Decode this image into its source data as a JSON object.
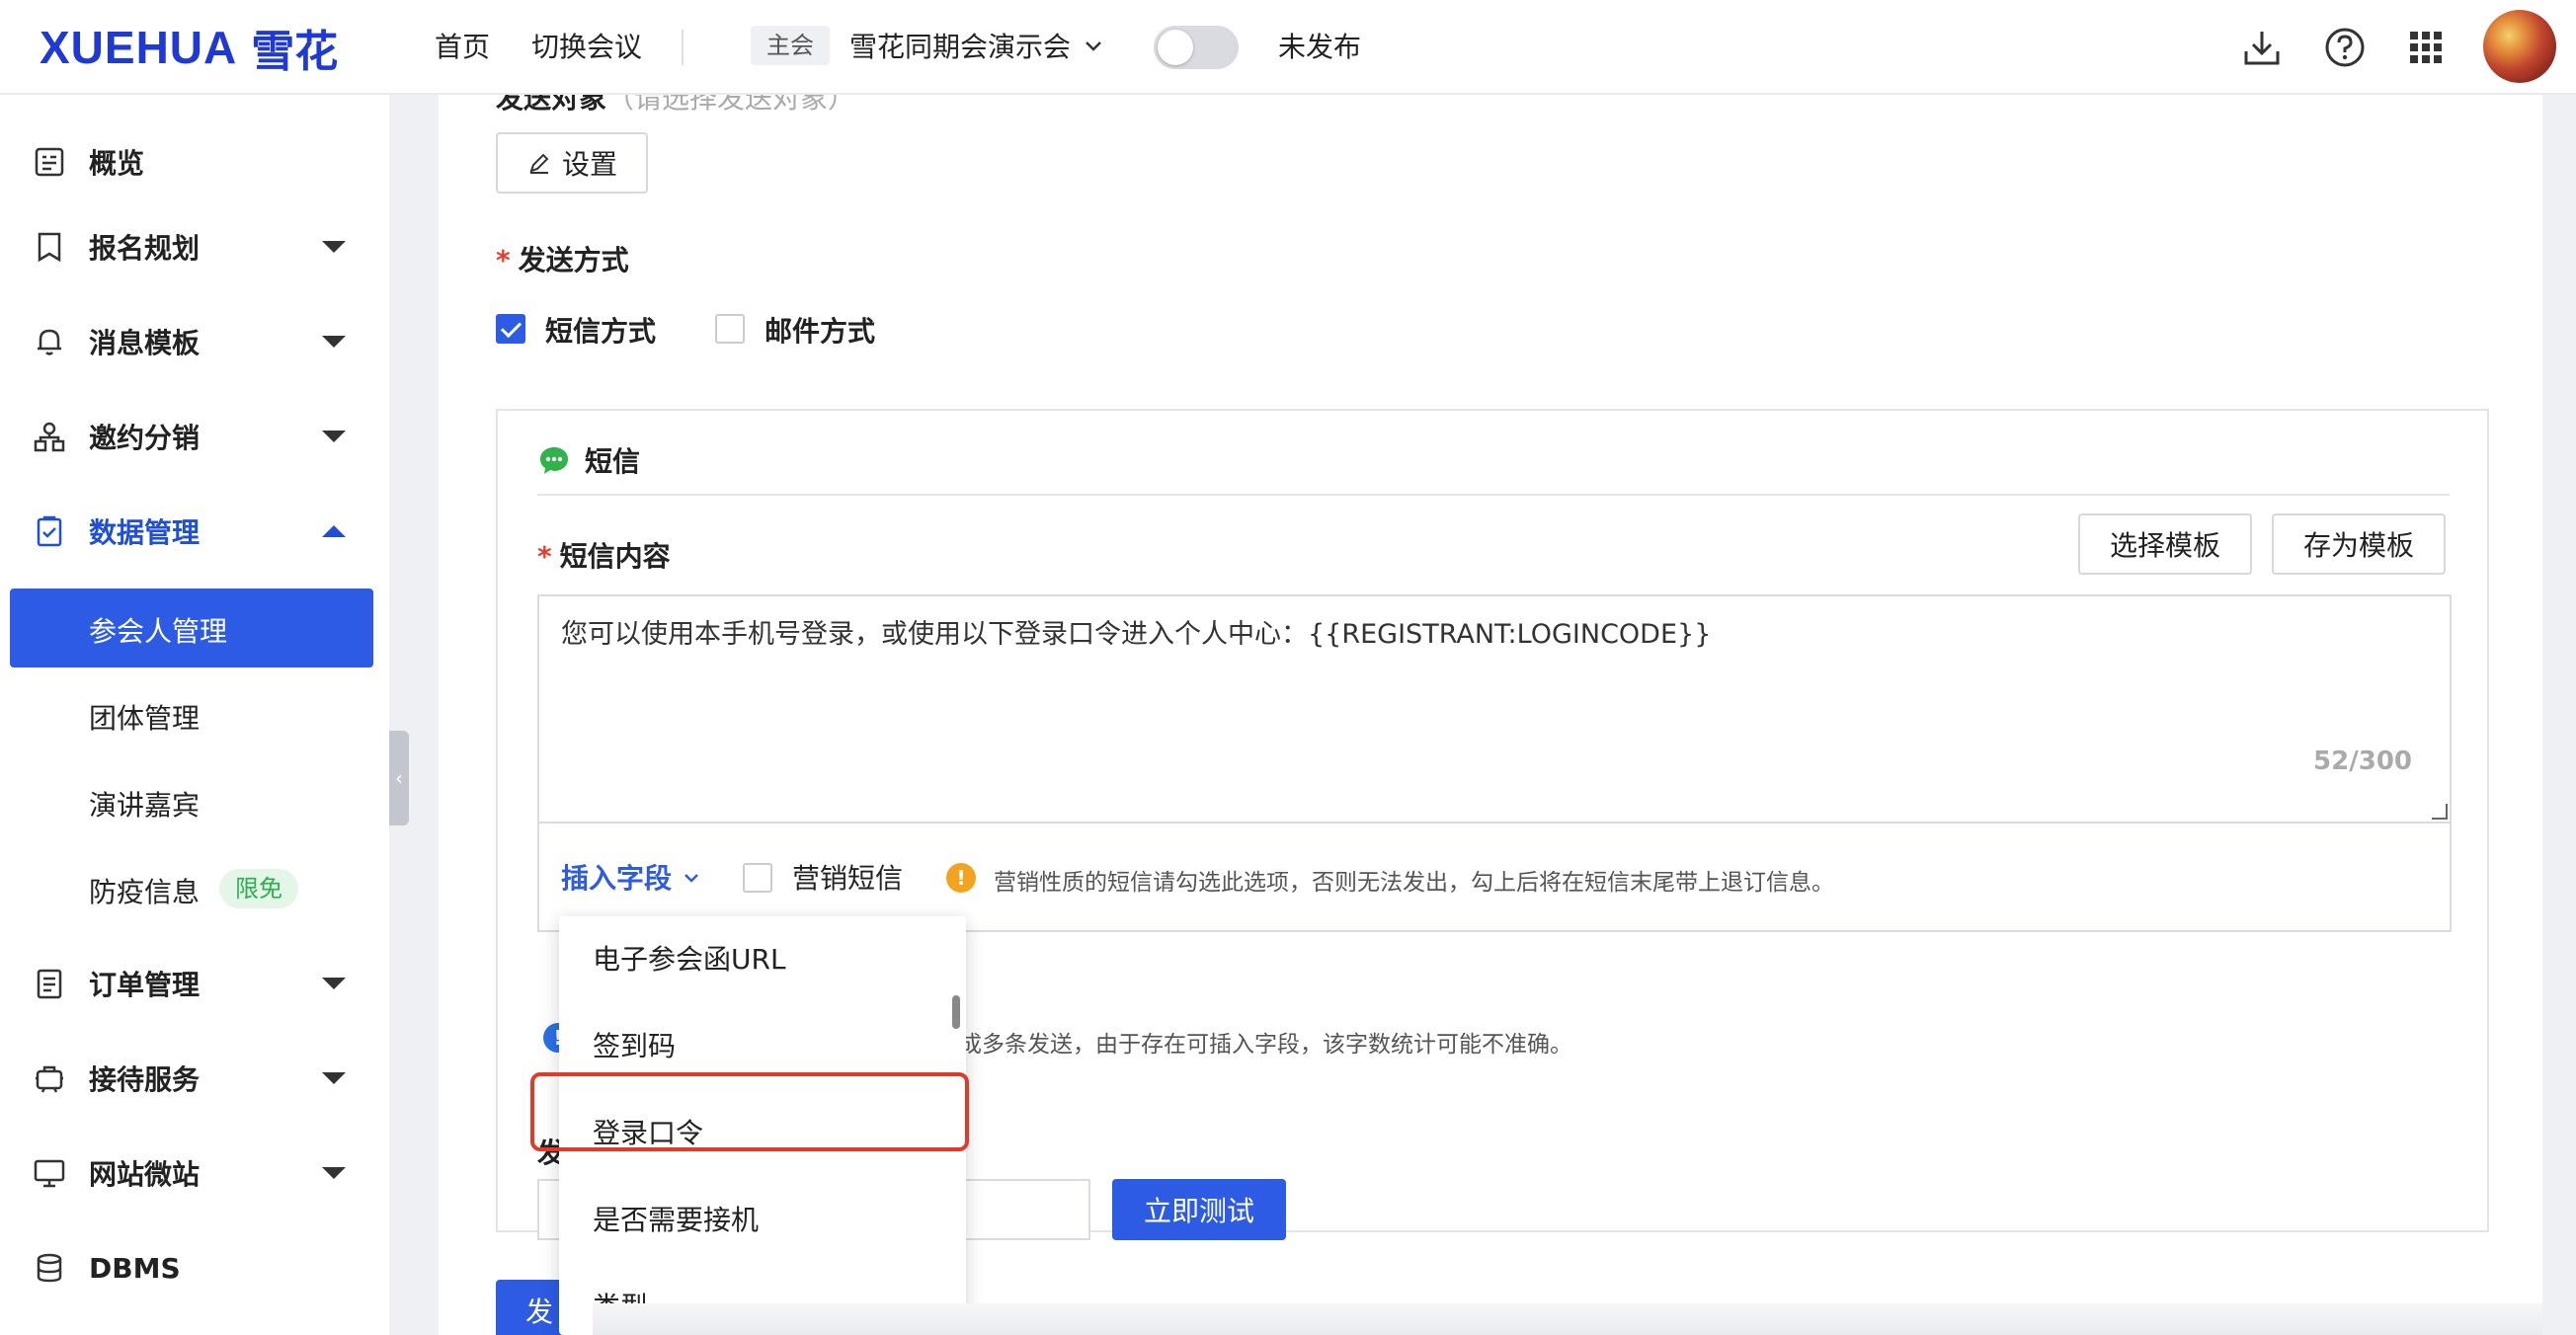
{
  "header": {
    "logo_latin": "XUEHUA",
    "logo_cn": "雪花",
    "nav_home": "首页",
    "nav_switch": "切换会议",
    "main_tag": "主会",
    "conference_name": "雪花同期会演示会",
    "publish_status": "未发布",
    "icons": [
      "download-icon",
      "help-icon",
      "apps-grid-icon",
      "avatar"
    ]
  },
  "sidebar": {
    "overview": "概览",
    "registration": "报名规划",
    "message_templates": "消息模板",
    "invitation": "邀约分销",
    "data_management": "数据管理",
    "attendee_management": "参会人管理",
    "group_management": "团体管理",
    "speakers": "演讲嘉宾",
    "epidemic_info": "防疫信息",
    "free_badge": "限免",
    "order_management": "订单管理",
    "reception": "接待服务",
    "website": "网站微站",
    "dbms": "DBMS"
  },
  "form": {
    "setting_button": "设置",
    "send_method_label": "发送方式",
    "sms_option": "短信方式",
    "email_option": "邮件方式",
    "sms_option_checked": true,
    "email_option_checked": false
  },
  "sms": {
    "title": "短信",
    "content_label": "短信内容",
    "choose_template": "选择模板",
    "save_template": "存为模板",
    "content": "您可以使用本手机号登录，或使用以下登录口令进入个人中心：{{REGISTRANT:LOGINCODE}}",
    "counter": "52/300",
    "insert_field": "插入字段",
    "marketing_sms": "营销短信",
    "marketing_warning": "营销性质的短信请勾选此选项，否则无法发出，勾上后将在短信末尾带上退订信息。",
    "info_partial": "分成多条发送，由于存在可插入字段，该字数统计可能不准确。",
    "phone_label_partial": "发",
    "test_now": "立即测试",
    "send_button_partial": "发"
  },
  "dropdown": {
    "items": [
      "电子参会函URL",
      "签到码",
      "登录口令",
      "是否需要接机",
      "类型"
    ],
    "highlighted": "登录口令"
  },
  "colors": {
    "brand": "#1f39d6",
    "primary": "#2d5be3",
    "warning": "#f4a321",
    "highlight_border": "#e23a26",
    "free_badge": "#2fae4f"
  }
}
